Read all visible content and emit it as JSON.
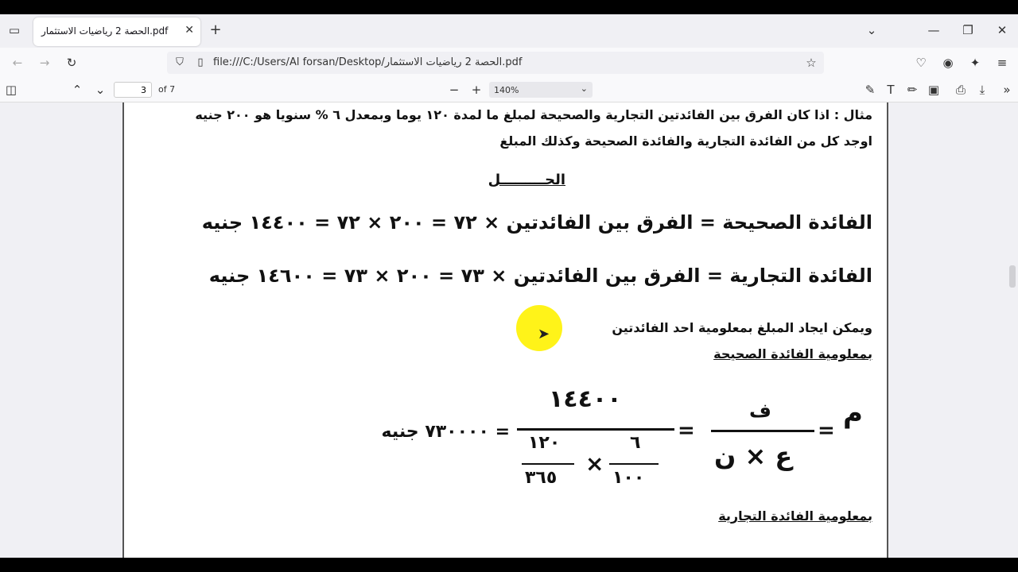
{
  "browser": {
    "tab_title": "الحصة 2 رياضيات الاستثمار.pdf",
    "url": "file:///C:/Users/Al forsan/Desktop/الحصة 2 رياضيات الاستثمار.pdf"
  },
  "pdf_toolbar": {
    "page_number": "3",
    "page_count": "of 7",
    "zoom": "140%"
  },
  "document": {
    "problem_line1": "مثال : اذا كان الفرق بين الفائدتين التجارية والصحيحة لمبلغ ما لمدة ١٢٠ يوما وبمعدل ٦ % سنويا هو ٢٠٠ جنيه",
    "problem_line2": "اوجد كل من الفائدة التجارية والفائدة الصحيحة وكذلك المبلغ",
    "solution_heading": "الحـــــــــل",
    "eq_true_interest": "الفائدة الصحيحة = الفرق بين الفائدتين × ٧٢ = ٢٠٠ × ٧٢ = ١٤٤٠٠ جنيه",
    "eq_commercial_interest": "الفائدة التجارية = الفرق بين الفائدتين × ٧٣ = ٢٠٠ × ٧٣ = ١٤٦٠٠ جنيه",
    "note_amount": "ويمكن ايجاد المبلغ بمعلومية احد الفائدتين",
    "subhead_true": "بمعلومية الفائدة الصحيحة",
    "formula_lhs": "م",
    "formula_numerator": "ف",
    "formula_denominator": "ع × ن",
    "calc_numerator": "١٤٤٠٠",
    "calc_rate_num": "٦",
    "calc_rate_den": "١٠٠",
    "calc_time_num": "١٢٠",
    "calc_time_den": "٣٦٥",
    "calc_result": "= ٧٣٠٠٠٠ جنيه",
    "subhead_commercial": "بمعلومية الفائدة التجارية"
  }
}
